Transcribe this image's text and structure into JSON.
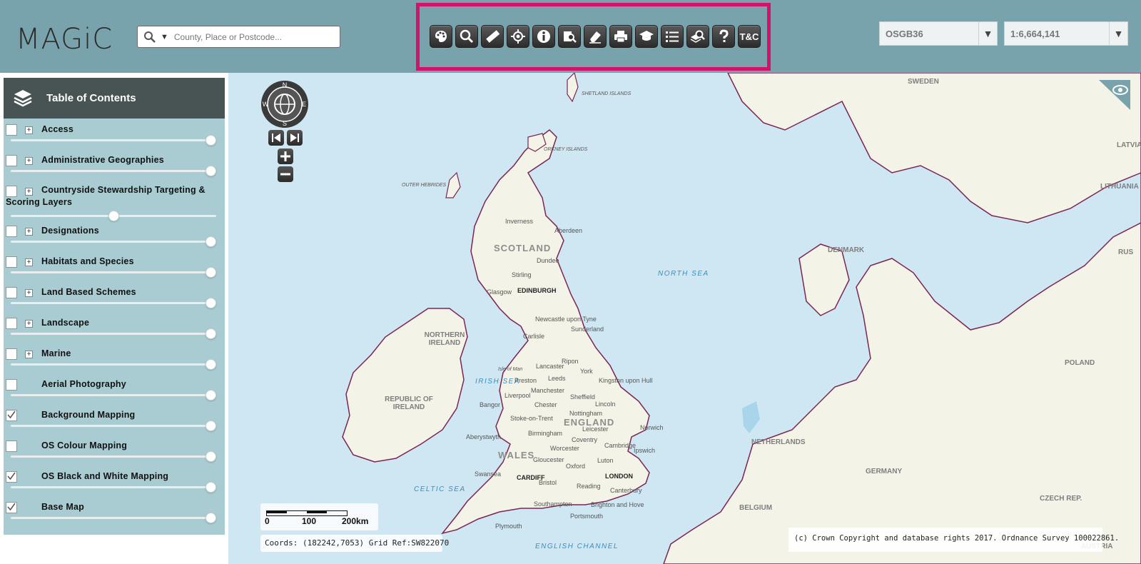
{
  "app": {
    "logo": "MAGiC"
  },
  "search": {
    "placeholder": "County, Place or Postcode..."
  },
  "toolbar": {
    "tools": [
      {
        "id": "themes",
        "icon": "palette-icon"
      },
      {
        "id": "search",
        "icon": "magnifier-icon"
      },
      {
        "id": "measure",
        "icon": "ruler-icon"
      },
      {
        "id": "locate",
        "icon": "crosshair-icon"
      },
      {
        "id": "info",
        "icon": "info-icon"
      },
      {
        "id": "query",
        "icon": "document-search-icon"
      },
      {
        "id": "erase",
        "icon": "eraser-icon"
      },
      {
        "id": "print",
        "icon": "printer-icon"
      },
      {
        "id": "help-guide",
        "icon": "mortarboard-icon"
      },
      {
        "id": "legend",
        "icon": "list-icon"
      },
      {
        "id": "layer-search",
        "icon": "layers-search-icon"
      },
      {
        "id": "help",
        "icon": "question-icon"
      },
      {
        "id": "terms",
        "label": "T&C"
      }
    ]
  },
  "projection": {
    "value": "OSGB36"
  },
  "scale": {
    "value": "1:6,664,141"
  },
  "toc": {
    "title": "Table of Contents",
    "layers": [
      {
        "name": "Access",
        "checked": false,
        "expandable": true,
        "opacity": 1.0
      },
      {
        "name": "Administrative Geographies",
        "checked": false,
        "expandable": true,
        "opacity": 1.0
      },
      {
        "name": "Countryside Stewardship Targeting & Scoring Layers",
        "checked": false,
        "expandable": true,
        "opacity": 0.5
      },
      {
        "name": "Designations",
        "checked": false,
        "expandable": true,
        "opacity": 1.0
      },
      {
        "name": "Habitats and Species",
        "checked": false,
        "expandable": true,
        "opacity": 1.0
      },
      {
        "name": "Land Based Schemes",
        "checked": false,
        "expandable": true,
        "opacity": 1.0
      },
      {
        "name": "Landscape",
        "checked": false,
        "expandable": true,
        "opacity": 1.0
      },
      {
        "name": "Marine",
        "checked": false,
        "expandable": true,
        "opacity": 1.0
      },
      {
        "name": "Aerial Photography",
        "checked": false,
        "expandable": false,
        "opacity": 1.0
      },
      {
        "name": "Background Mapping",
        "checked": true,
        "expandable": false,
        "opacity": 1.0
      },
      {
        "name": "OS Colour Mapping",
        "checked": false,
        "expandable": false,
        "opacity": 1.0
      },
      {
        "name": "OS Black and White Mapping",
        "checked": true,
        "expandable": false,
        "opacity": 1.0
      },
      {
        "name": "Base Map",
        "checked": true,
        "expandable": false,
        "opacity": 1.0
      }
    ]
  },
  "map": {
    "compass": {
      "n": "N",
      "s": "S",
      "e": "E",
      "w": "W"
    },
    "labels": {
      "scotland": "SCOTLAND",
      "england": "ENGLAND",
      "wales": "WALES",
      "northern_ireland": "NORTHERN IRELAND",
      "republic_of_ireland": "REPUBLIC OF IRELAND",
      "denmark": "DENMARK",
      "netherlands": "NETHERLANDS",
      "germany": "GERMANY",
      "belgium": "BELGIUM",
      "poland": "POLAND",
      "czech": "CZECH REP.",
      "sweden": "SWEDEN",
      "lithuania": "LITHUANIA",
      "latvia": "LATVIA",
      "russia": "RUS",
      "austria": "AUSTRIA",
      "north_sea": "NORTH SEA",
      "irish_sea": "IRISH SEA",
      "celtic_sea": "CELTIC SEA",
      "english_channel": "ENGLISH CHANNEL",
      "shetland": "SHETLAND ISLANDS",
      "orkney": "ORKNEY ISLANDS",
      "outer_hebrides": "OUTER HEBRIDES",
      "isle_of_man": "Isle of Man",
      "edinburgh": "EDINBURGH",
      "cardiff": "CARDIFF",
      "london": "LONDON",
      "inverness": "Inverness",
      "aberdeen": "Aberdeen",
      "dundee": "Dundee",
      "stirling": "Stirling",
      "glasgow": "Glasgow",
      "newcastle": "Newcastle upon Tyne",
      "sunderland": "Sunderland",
      "carlisle": "Carlisle",
      "ripon": "Ripon",
      "lancaster": "Lancaster",
      "york": "York",
      "leeds": "Leeds",
      "hull": "Kingston upon Hull",
      "preston": "Preston",
      "manchester": "Manchester",
      "liverpool": "Liverpool",
      "sheffield": "Sheffield",
      "bangor": "Bangor",
      "chester": "Chester",
      "lincoln": "Lincoln",
      "nottingham": "Nottingham",
      "stoke": "Stoke-on-Trent",
      "leicester": "Leicester",
      "norwich": "Norwich",
      "aberystwyth": "Aberystwyth",
      "birmingham": "Birmingham",
      "coventry": "Coventry",
      "worcester": "Worcester",
      "cambridge": "Cambridge",
      "ipswich": "Ipswich",
      "gloucester": "Gloucester",
      "luton": "Luton",
      "oxford": "Oxford",
      "swansea": "Swansea",
      "bristol": "Bristol",
      "reading": "Reading",
      "canterbury": "Canterbury",
      "southampton": "Southampton",
      "brighton": "Brighton and Hove",
      "portsmouth": "Portsmouth",
      "plymouth": "Plymouth"
    },
    "scalebar": {
      "l0": "0",
      "l1": "100",
      "l2": "200km"
    },
    "coords": "Coords: (182242,7053) Grid Ref:SW822070",
    "copyright": "(c) Crown Copyright and database rights 2017. Ordnance Survey 100022861."
  },
  "colors": {
    "header": "#78a3ac",
    "sidebar": "#a9ccd2",
    "highlight": "#d6116b",
    "sea": "#cfe7f3",
    "land": "#f4f3e8",
    "coast": "#7b2553"
  }
}
